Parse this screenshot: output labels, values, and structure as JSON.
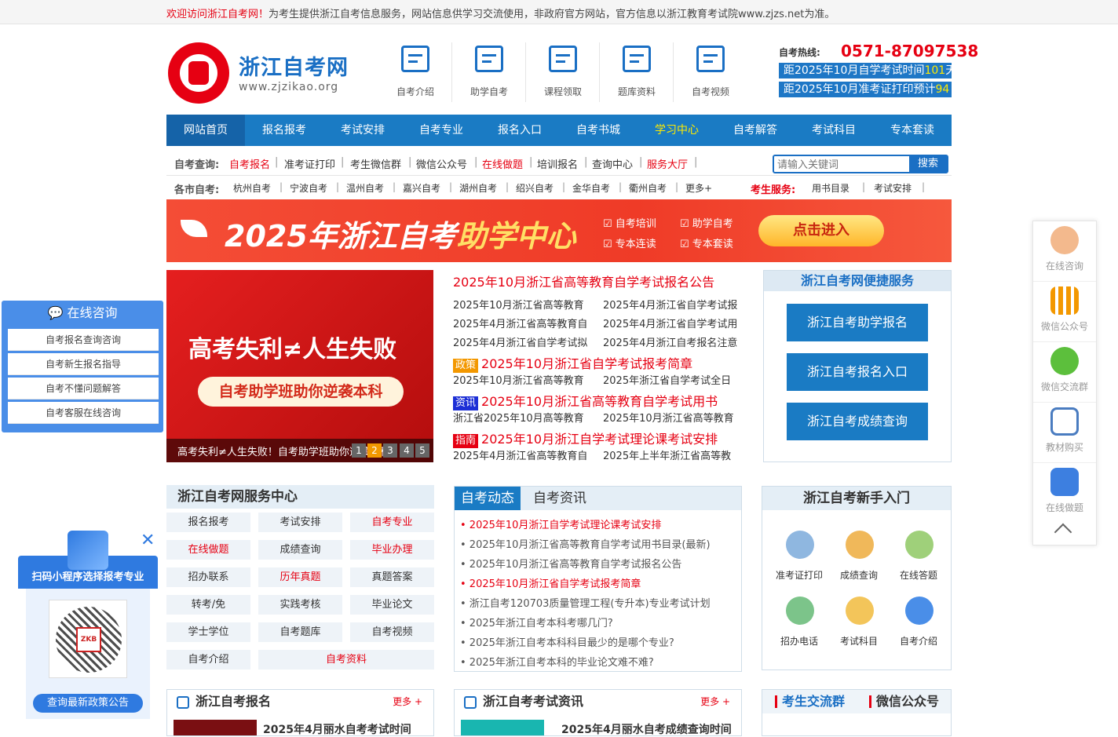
{
  "topbar": {
    "welcome": "欢迎访问浙江自考网！",
    "notice": "为考生提供浙江自考信息服务，网站信息供学习交流使用，非政府官方网站，官方信息以浙江教育考试院www.zjzs.net为准。"
  },
  "logo": {
    "title": "浙江自考网",
    "url": "www.zjzikao.org"
  },
  "top_icons": [
    {
      "label": "自考介绍",
      "icon": "monitor-icon"
    },
    {
      "label": "助学自考",
      "icon": "stack-icon"
    },
    {
      "label": "课程领取",
      "icon": "classroom-icon"
    },
    {
      "label": "题库资料",
      "icon": "book-icon"
    },
    {
      "label": "自考视频",
      "icon": "video-icon"
    }
  ],
  "hotline": {
    "label": "自考热线:",
    "number": "0571-87097538",
    "countdown1_pre": "距2025年10月自学考试时间",
    "countdown1_num": "101",
    "countdown1_unit": "天",
    "countdown2_pre": "距2025年10月准考证打印预计",
    "countdown2_num": "94"
  },
  "nav": [
    "网站首页",
    "报名报考",
    "考试安排",
    "自考专业",
    "报名入口",
    "自考书城",
    "学习中心",
    "自考解答",
    "考试科目",
    "专本套读"
  ],
  "query": {
    "label": "自考查询:",
    "links": [
      "自考报名",
      "准考证打印",
      "考生微信群",
      "微信公众号",
      "在线做题",
      "培训报名",
      "查询中心",
      "服务大厅"
    ]
  },
  "search": {
    "placeholder": "请输入关键词",
    "button": "搜索"
  },
  "cities": {
    "label": "各市自考:",
    "links": [
      "杭州自考",
      "宁波自考",
      "温州自考",
      "嘉兴自考",
      "湖州自考",
      "绍兴自考",
      "金华自考",
      "衢州自考",
      "更多+"
    ],
    "service_label": "考生服务:",
    "service_links": [
      "用书目录",
      "考试安排"
    ]
  },
  "banner": {
    "title_a": "2025年浙江自考",
    "title_b": "助学中心",
    "checks": [
      "自考培训",
      "助学自考",
      "专本连读",
      "专本套读"
    ],
    "cta": "点击进入"
  },
  "slide": {
    "line1": "高考失利≠人生失败",
    "line2": "自考助学班助你逆袭本科",
    "caption": "高考失利≠人生失败！自考助学班助你逆袭本科",
    "dots": [
      "1",
      "2",
      "3",
      "4",
      "5"
    ]
  },
  "news": {
    "headline": "2025年10月浙江省高等教育自学考试报名公告",
    "rows": [
      [
        "2025年10月浙江省高等教育",
        "2025年4月浙江省自学考试报"
      ],
      [
        "2025年4月浙江省高等教育自",
        "2025年4月浙江省自学考试用"
      ],
      [
        "2025年4月浙江省自学考试拟",
        "2025年4月浙江自考报名注意"
      ]
    ],
    "tag1": "政策",
    "head2": "2025年10月浙江省自学考试报考简章",
    "row4": [
      "2025年10月浙江省高等教育",
      "2025年浙江省自学考试全日"
    ],
    "tag2": "资讯",
    "head3": "2025年10月浙江省高等教育自学考试用书",
    "row5": [
      "浙江省2025年10月高等教育",
      "2025年10月浙江省高等教育"
    ],
    "tag3": "指南",
    "head4": "2025年10月浙江自学考试理论课考试安排",
    "row6": [
      "2025年4月浙江省高等教育自",
      "2025年上半年浙江省高等教"
    ]
  },
  "quick": {
    "title": "浙江自考网便捷服务",
    "buttons": [
      "浙江自考助学报名",
      "浙江自考报名入口",
      "浙江自考成绩查询"
    ]
  },
  "service_center": {
    "title": "浙江自考网服务中心",
    "items": [
      {
        "t": "报名报考",
        "red": false
      },
      {
        "t": "考试安排",
        "red": false
      },
      {
        "t": "自考专业",
        "red": true
      },
      {
        "t": "在线做题",
        "red": true
      },
      {
        "t": "成绩查询",
        "red": false
      },
      {
        "t": "毕业办理",
        "red": true
      },
      {
        "t": "招办联系",
        "red": false
      },
      {
        "t": "历年真题",
        "red": true
      },
      {
        "t": "真题答案",
        "red": false
      },
      {
        "t": "转考/免",
        "red": false
      },
      {
        "t": "实践考核",
        "red": false
      },
      {
        "t": "毕业论文",
        "red": false
      },
      {
        "t": "学士学位",
        "red": false
      },
      {
        "t": "自考题库",
        "red": false
      },
      {
        "t": "自考视频",
        "red": false
      },
      {
        "t": "自考介绍",
        "red": false
      },
      {
        "t": "自考资料",
        "red": true
      }
    ]
  },
  "dynamic": {
    "tabs": [
      "自考动态",
      "自考资讯"
    ],
    "items": [
      {
        "t": "• 2025年10月浙江自学考试理论课考试安排",
        "red": true
      },
      {
        "t": "• 2025年10月浙江省高等教育自学考试用书目录(最新)",
        "red": false
      },
      {
        "t": "• 2025年10月浙江省高等教育自学考试报名公告",
        "red": false
      },
      {
        "t": "• 2025年10月浙江省自学考试报考简章",
        "red": true
      },
      {
        "t": "• 浙江自考120703质量管理工程(专升本)专业考试计划",
        "red": false
      },
      {
        "t": "• 2025年浙江自考本科考哪几门?",
        "red": false
      },
      {
        "t": "• 2025年浙江自考本科科目最少的是哪个专业?",
        "red": false
      },
      {
        "t": "• 2025年浙江自考本科的毕业论文难不难?",
        "red": false
      }
    ]
  },
  "newbie": {
    "title": "浙江自考新手入门",
    "items": [
      {
        "label": "准考证打印",
        "icon": "admission-ticket-icon"
      },
      {
        "label": "成绩查询",
        "icon": "search-score-icon"
      },
      {
        "label": "在线答题",
        "icon": "online-quiz-icon"
      },
      {
        "label": "招办电话",
        "icon": "telephone-icon"
      },
      {
        "label": "考试科目",
        "icon": "alarm-clock-icon"
      },
      {
        "label": "自考介绍",
        "icon": "intro-icon"
      }
    ]
  },
  "bottom": {
    "p1_title": "浙江自考报名",
    "p1_more": "更多 +",
    "p1_sub": "2025年4月丽水自考考试时间",
    "p2_title": "浙江自考考试资讯",
    "p2_more": "更多 +",
    "p2_sub": "2025年4月丽水自考成绩查询时间",
    "p3_tab1": "考生交流群",
    "p3_tab2": "微信公众号"
  },
  "left_float": {
    "title": "在线咨询",
    "items": [
      "自考报名查询咨询",
      "自考新生报名指导",
      "自考不懂问题解答",
      "自考客服在线咨询"
    ]
  },
  "qr_float": {
    "title": "扫码小程序选择报考专业",
    "qr_text": "ZKB",
    "button": "查询最新政策公告"
  },
  "right_float": [
    {
      "label": "在线咨询",
      "icon": "customer-service-icon"
    },
    {
      "label": "微信公众号",
      "icon": "qrcode-icon"
    },
    {
      "label": "微信交流群",
      "icon": "wechat-icon"
    },
    {
      "label": "教材购买",
      "icon": "cart-icon"
    },
    {
      "label": "在线做题",
      "icon": "edit-icon"
    }
  ]
}
